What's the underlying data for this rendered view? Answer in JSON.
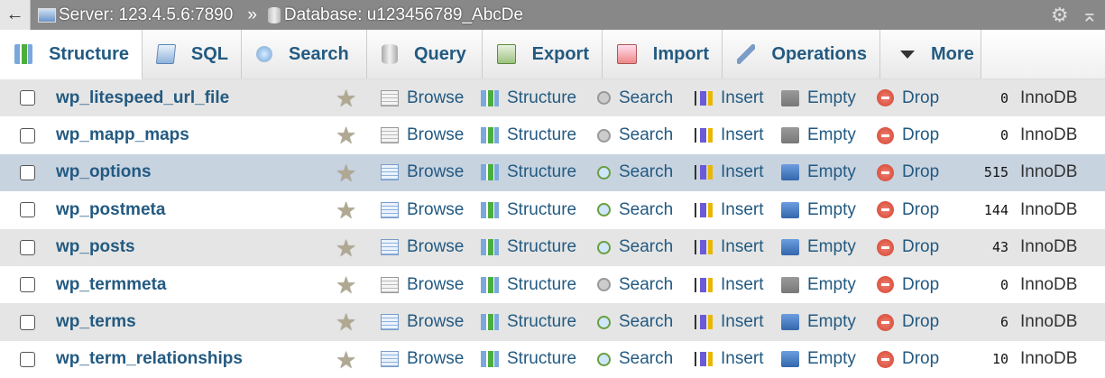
{
  "topbar": {
    "back_icon": "←",
    "server": "Server: 123.4.5.6:7890",
    "separator": "»",
    "database": "Database: u123456789_AbcDe",
    "settings_icon": "⚙",
    "collapse_icon": "⌅"
  },
  "tabs": [
    {
      "label": "Structure",
      "icon": "structure",
      "active": true
    },
    {
      "label": "SQL",
      "icon": "sql"
    },
    {
      "label": "Search",
      "icon": "search"
    },
    {
      "label": "Query",
      "icon": "query"
    },
    {
      "label": "Export",
      "icon": "export"
    },
    {
      "label": "Import",
      "icon": "import"
    },
    {
      "label": "Operations",
      "icon": "ops"
    },
    {
      "label": "More",
      "icon": "more"
    }
  ],
  "actions": {
    "browse": "Browse",
    "structure": "Structure",
    "search": "Search",
    "insert": "Insert",
    "empty": "Empty",
    "drop": "Drop"
  },
  "tables": [
    {
      "name": "wp_litespeed_url_file",
      "rows": "0",
      "engine": "InnoDB"
    },
    {
      "name": "wp_mapp_maps",
      "rows": "0",
      "engine": "InnoDB"
    },
    {
      "name": "wp_options",
      "rows": "515",
      "engine": "InnoDB",
      "marked": true
    },
    {
      "name": "wp_postmeta",
      "rows": "144",
      "engine": "InnoDB"
    },
    {
      "name": "wp_posts",
      "rows": "43",
      "engine": "InnoDB"
    },
    {
      "name": "wp_termmeta",
      "rows": "0",
      "engine": "InnoDB"
    },
    {
      "name": "wp_terms",
      "rows": "6",
      "engine": "InnoDB"
    },
    {
      "name": "wp_term_relationships",
      "rows": "10",
      "engine": "InnoDB"
    }
  ]
}
